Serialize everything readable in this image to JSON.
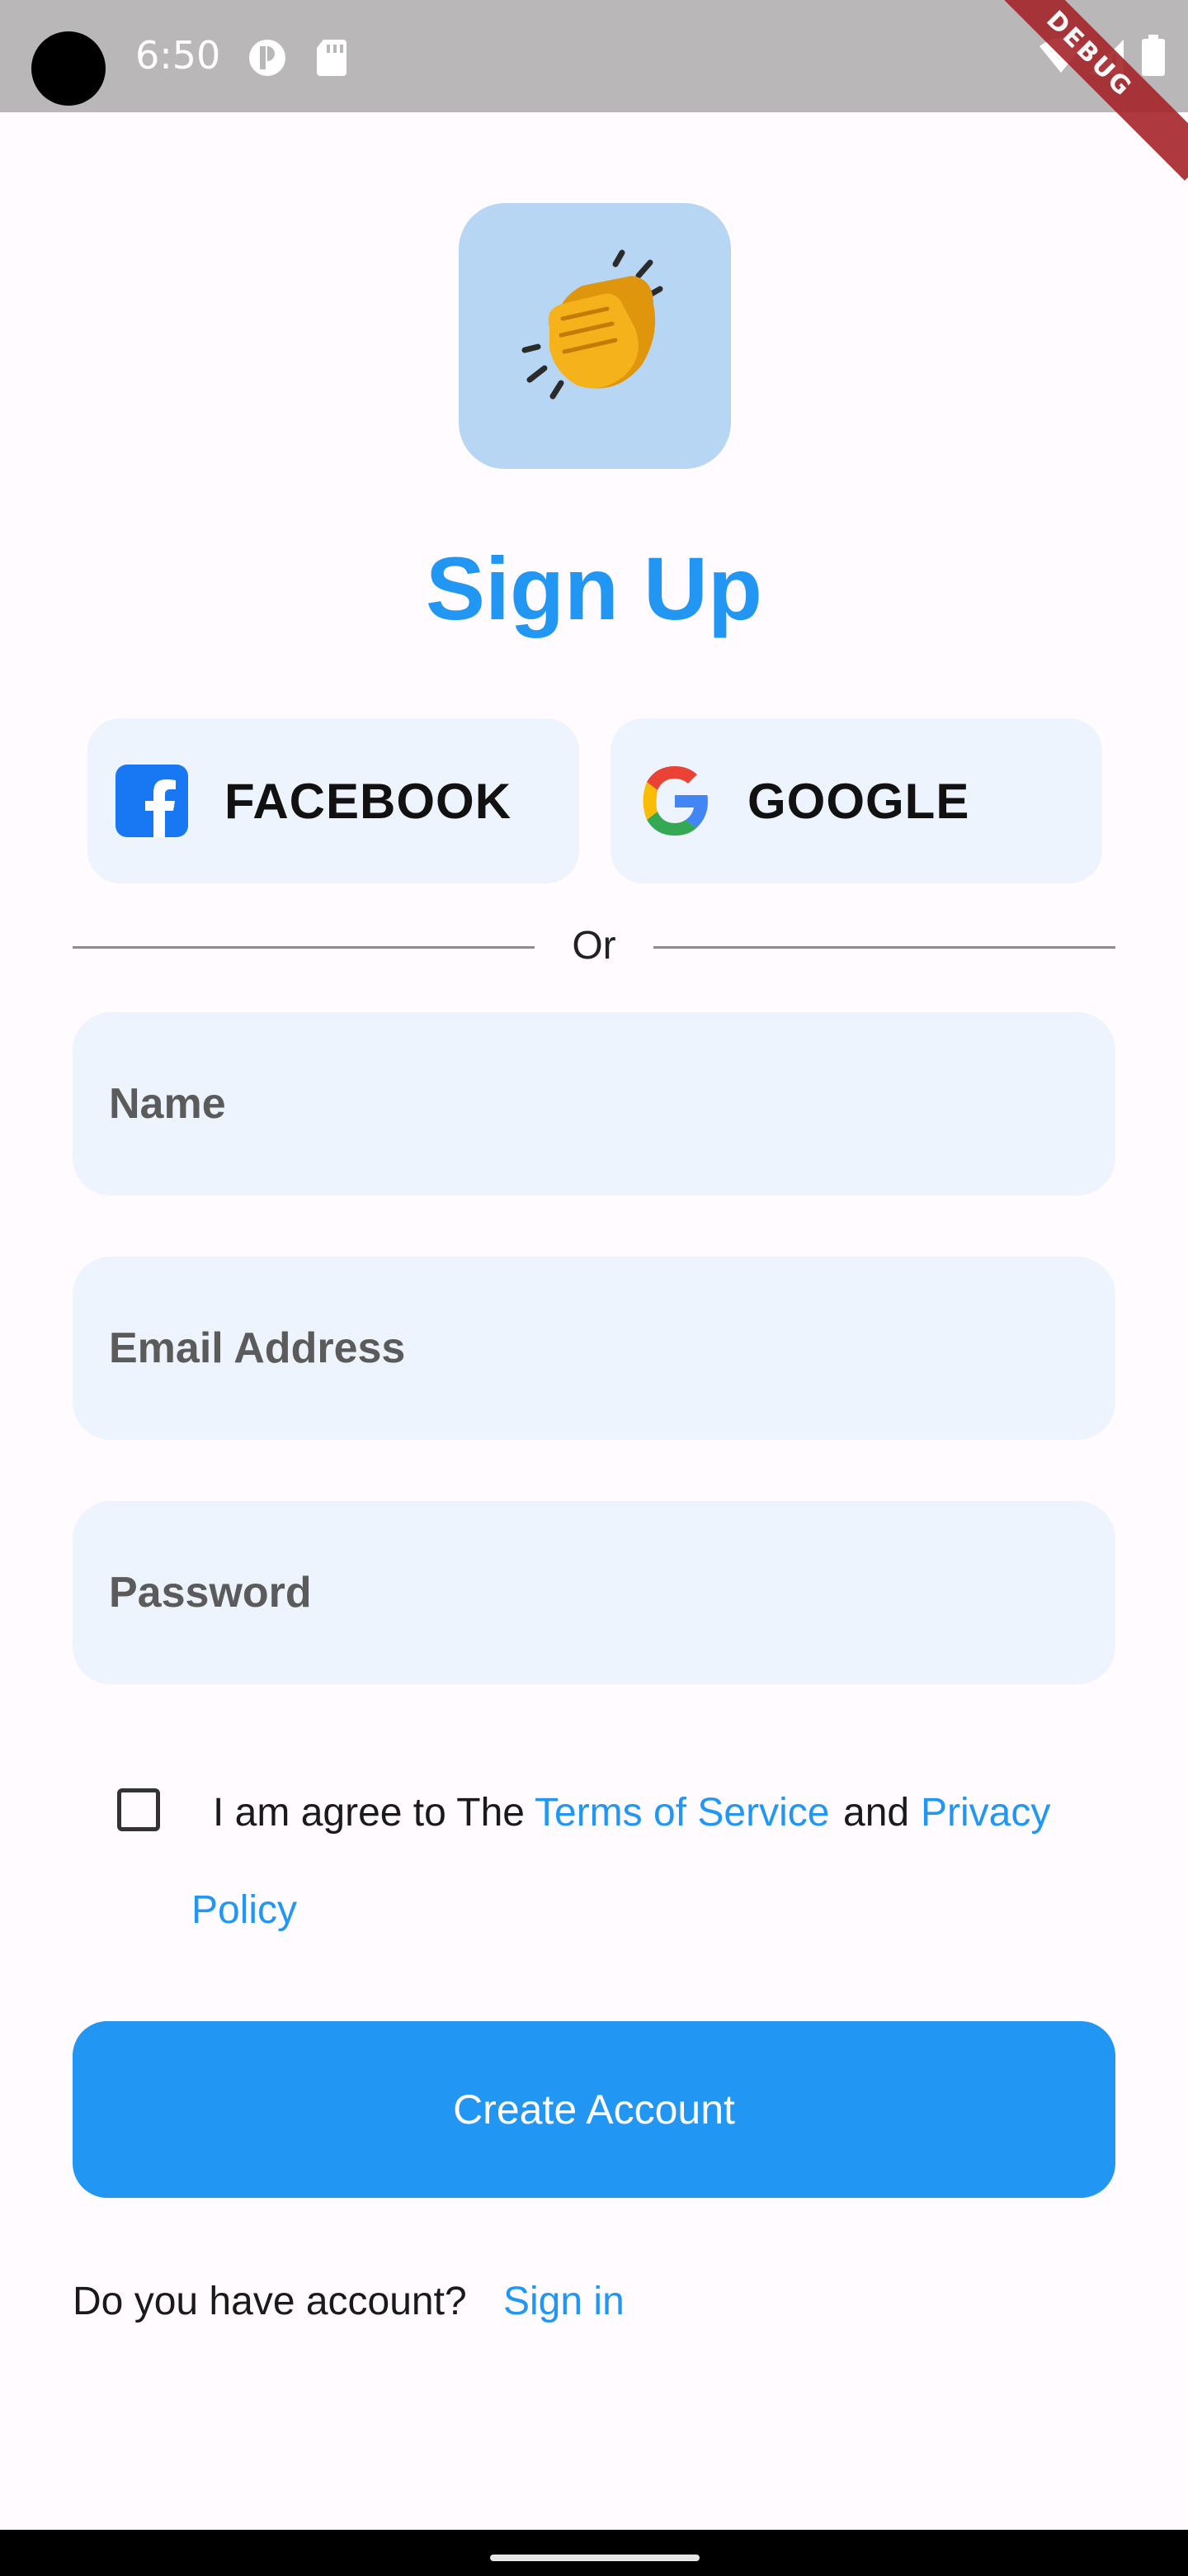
{
  "status_bar": {
    "time": "6:50",
    "debug_label": "DEBUG",
    "colors": {
      "background": "#b9b7b8"
    }
  },
  "logo": {
    "emoji": "👏",
    "icon_name": "clapping-hands-icon"
  },
  "title": "Sign Up",
  "social": {
    "facebook_label": "FACEBOOK",
    "google_label": "GOOGLE"
  },
  "divider_text": "Or",
  "form": {
    "name_placeholder": "Name",
    "email_placeholder": "Email Address",
    "password_placeholder": "Password"
  },
  "terms": {
    "prefix": "I am agree to The",
    "terms_link": "Terms of Service",
    "middle": "and",
    "privacy_link_part1": "Privacy",
    "privacy_link_part2": "Policy"
  },
  "create_button": "Create Account",
  "footer": {
    "prompt": "Do you have account?",
    "signin_link": "Sign in"
  },
  "colors": {
    "accent": "#2196f3",
    "field_background": "#edf4fd",
    "logo_background": "#b6d6f3",
    "page_background": "#fffbfe"
  }
}
